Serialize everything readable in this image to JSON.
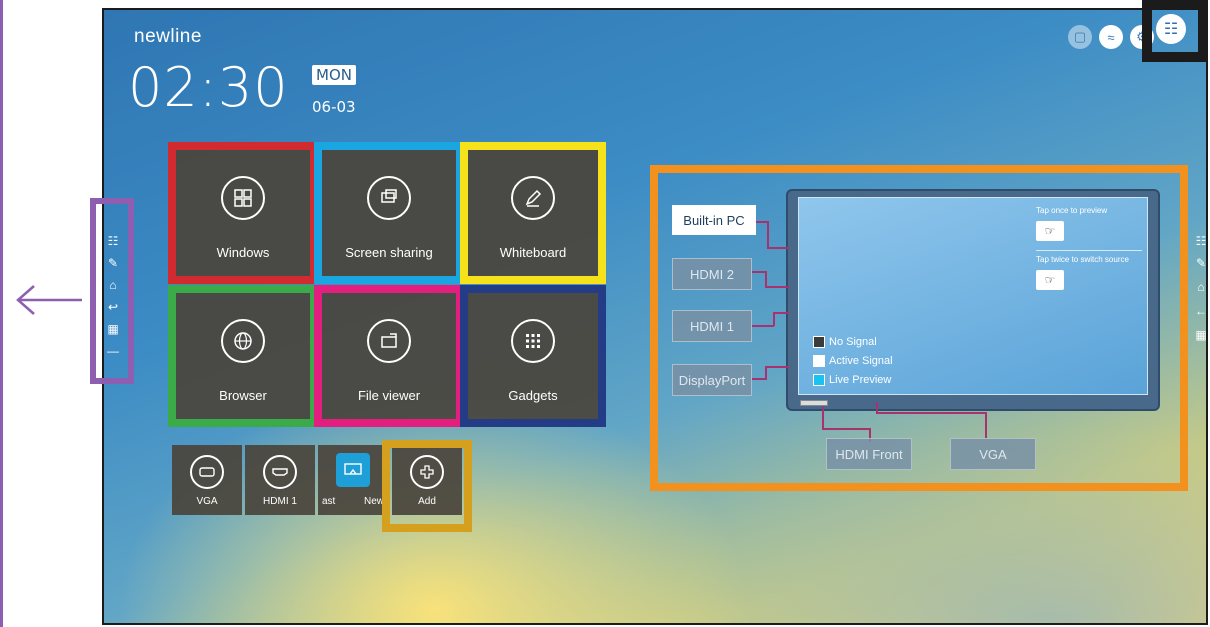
{
  "brand": "newline",
  "clock": {
    "time": "02:30",
    "day": "MON",
    "date": "06-03"
  },
  "top_icons": [
    "lock-icon",
    "wifi-icon",
    "gear-icon",
    "source-icon"
  ],
  "tiles": [
    {
      "label": "Windows",
      "icon": "windows-icon",
      "highlight": "#d22b2f"
    },
    {
      "label": "Screen sharing",
      "icon": "screen-share-icon",
      "highlight": "#1aa6e0"
    },
    {
      "label": "Whiteboard",
      "icon": "pencil-icon",
      "highlight": "#f5e21b"
    },
    {
      "label": "Browser",
      "icon": "globe-icon",
      "highlight": "#3aab48"
    },
    {
      "label": "File viewer",
      "icon": "folder-icon",
      "highlight": "#e21f7e"
    },
    {
      "label": "Gadgets",
      "icon": "grid-icon",
      "highlight": "#243b86"
    }
  ],
  "small_tiles": [
    {
      "label": "VGA",
      "icon": "vga-icon"
    },
    {
      "label": "HDMI 1",
      "icon": "hdmi-icon"
    },
    {
      "label": "ast",
      "icon": "cast-icon"
    },
    {
      "label": "New",
      "icon": ""
    },
    {
      "label": "Add",
      "icon": "plus-icon"
    }
  ],
  "add_highlight": "#d4a01e",
  "source_panel": {
    "inputs": [
      "Built-in PC",
      "HDMI 2",
      "HDMI 1",
      "DisplayPort"
    ],
    "bottom_inputs": [
      "HDMI Front",
      "VGA"
    ],
    "hint_preview": "Tap once to preview",
    "hint_switch": "Tap twice to switch source",
    "legend": [
      {
        "label": "No Signal",
        "color": "#3b3b3b"
      },
      {
        "label": "Active Signal",
        "color": "#ffffff"
      },
      {
        "label": "Live Preview",
        "color": "#19c3f0"
      }
    ],
    "border_color": "#f3911f"
  }
}
